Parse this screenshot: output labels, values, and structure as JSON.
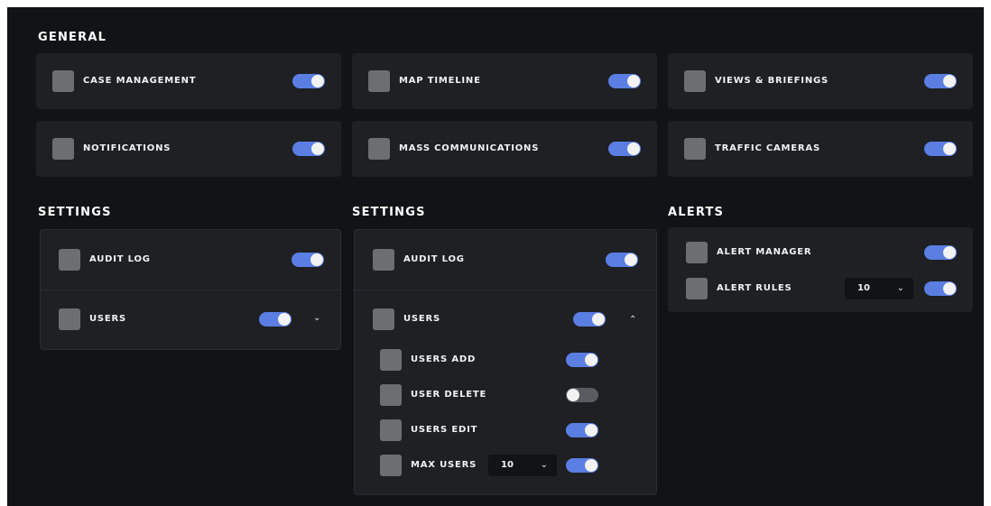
{
  "general": {
    "title": "GENERAL",
    "items": [
      {
        "label": "CASE MANAGEMENT",
        "enabled": true
      },
      {
        "label": "MAP TIMELINE",
        "enabled": true
      },
      {
        "label": "VIEWS & BRIEFINGS",
        "enabled": true
      },
      {
        "label": "NOTIFICATIONS",
        "enabled": true
      },
      {
        "label": "MASS COMMUNICATIONS",
        "enabled": true
      },
      {
        "label": "TRAFFIC CAMERAS",
        "enabled": true
      }
    ]
  },
  "settings_collapsed": {
    "title": "SETTINGS",
    "audit_log": {
      "label": "AUDIT LOG",
      "enabled": true
    },
    "users": {
      "label": "USERS",
      "enabled": true,
      "expanded": false
    }
  },
  "settings_expanded": {
    "title": "SETTINGS",
    "audit_log": {
      "label": "AUDIT LOG",
      "enabled": true
    },
    "users": {
      "label": "USERS",
      "enabled": true,
      "expanded": true
    },
    "sub_items": [
      {
        "label": "USERS ADD",
        "enabled": true
      },
      {
        "label": "USER DELETE",
        "enabled": false
      },
      {
        "label": "USERS EDIT",
        "enabled": true
      },
      {
        "label": "MAX USERS",
        "enabled": true,
        "select_value": "10"
      }
    ]
  },
  "alerts": {
    "title": "ALERTS",
    "alert_manager": {
      "label": "ALERT MANAGER",
      "enabled": true
    },
    "alert_rules": {
      "label": "ALERT RULES",
      "enabled": true,
      "select_value": "10"
    }
  },
  "icons": {
    "chevron_down": "⌄",
    "chevron_up": "⌃"
  },
  "colors": {
    "background": "#121316",
    "card": "#1e2024",
    "toggle_on": "#5b7ee3",
    "toggle_off": "#5a5b60",
    "checkbox": "#6d6e72"
  }
}
